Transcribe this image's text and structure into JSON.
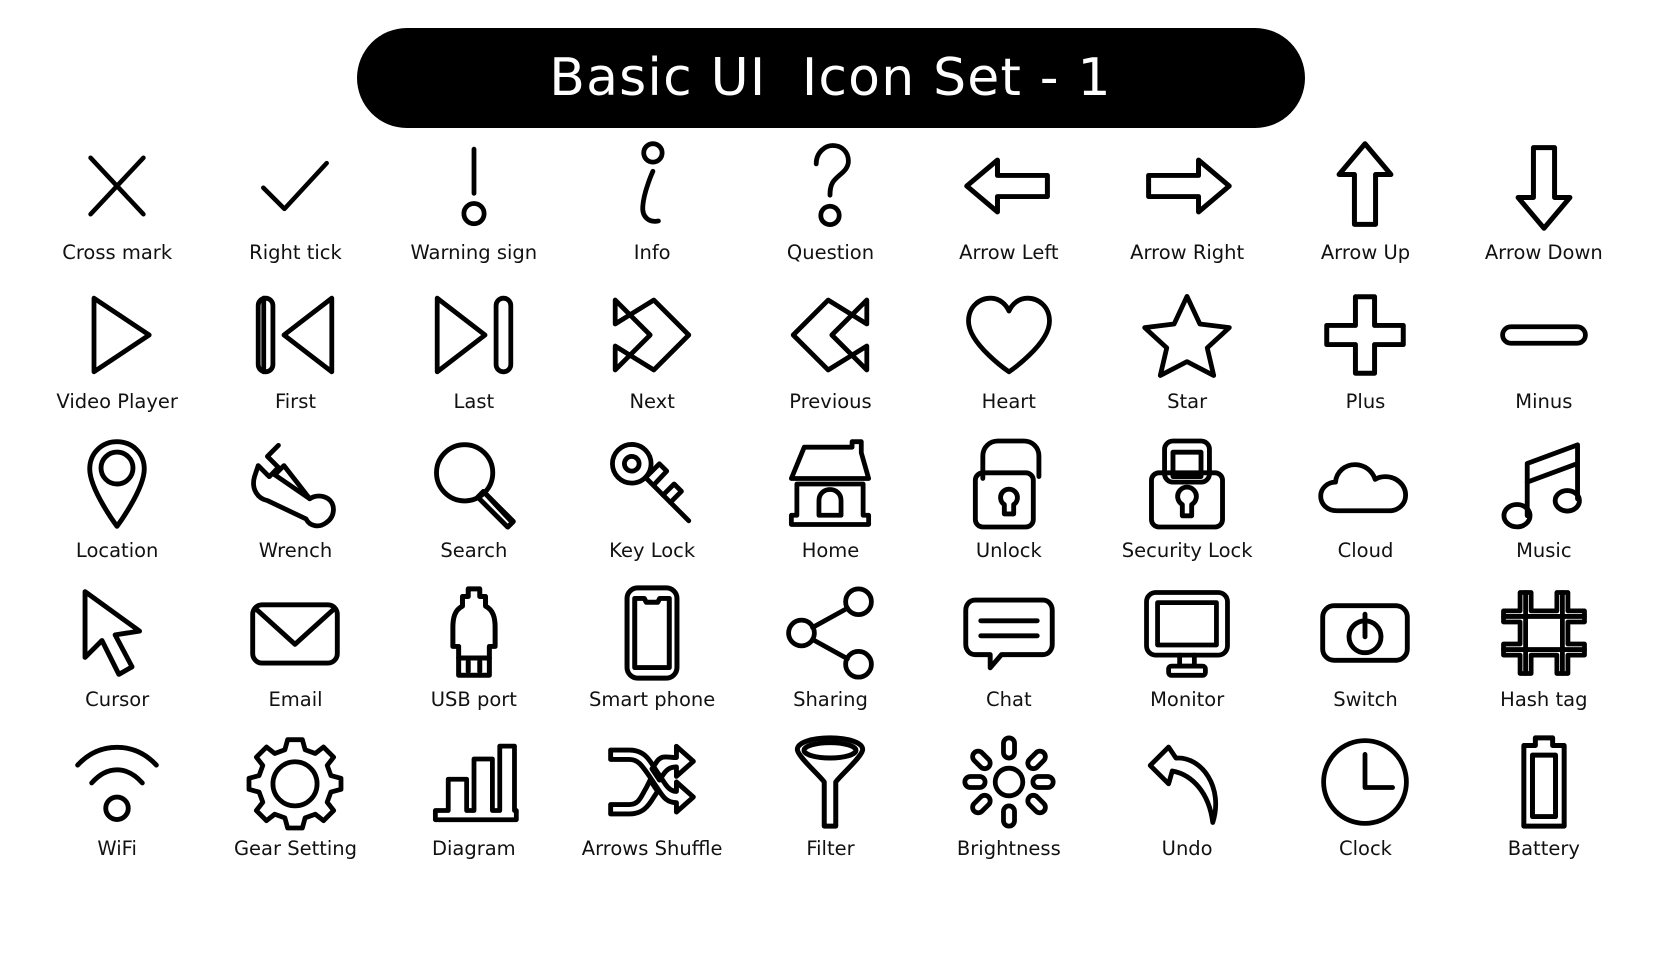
{
  "banner": {
    "title": "Basic UI  Icon Set - 1",
    "background_color": "#000000",
    "text_color": "#ffffff"
  },
  "style": {
    "icon_stroke_color": "#000000",
    "page_background": "#ffffff",
    "caption_color": "#111111",
    "icon_style": "outline"
  },
  "grid": {
    "columns": 9,
    "rows": 5
  },
  "icons": [
    {
      "name": "cross-mark",
      "label": "Cross mark"
    },
    {
      "name": "right-tick",
      "label": "Right tick"
    },
    {
      "name": "warning-sign",
      "label": "Warning sign"
    },
    {
      "name": "info",
      "label": "Info"
    },
    {
      "name": "question",
      "label": "Question"
    },
    {
      "name": "arrow-left",
      "label": "Arrow Left"
    },
    {
      "name": "arrow-right",
      "label": "Arrow Right"
    },
    {
      "name": "arrow-up",
      "label": "Arrow Up"
    },
    {
      "name": "arrow-down",
      "label": "Arrow Down"
    },
    {
      "name": "video-player",
      "label": "Video Player"
    },
    {
      "name": "first",
      "label": "First"
    },
    {
      "name": "last",
      "label": "Last"
    },
    {
      "name": "next",
      "label": "Next"
    },
    {
      "name": "previous",
      "label": "Previous"
    },
    {
      "name": "heart",
      "label": "Heart"
    },
    {
      "name": "star",
      "label": "Star"
    },
    {
      "name": "plus",
      "label": "Plus"
    },
    {
      "name": "minus",
      "label": "Minus"
    },
    {
      "name": "location",
      "label": "Location"
    },
    {
      "name": "wrench",
      "label": "Wrench"
    },
    {
      "name": "search",
      "label": "Search"
    },
    {
      "name": "key-lock",
      "label": "Key Lock"
    },
    {
      "name": "home",
      "label": "Home"
    },
    {
      "name": "unlock",
      "label": "Unlock"
    },
    {
      "name": "security-lock",
      "label": "Security Lock"
    },
    {
      "name": "cloud",
      "label": "Cloud"
    },
    {
      "name": "music",
      "label": "Music"
    },
    {
      "name": "cursor",
      "label": "Cursor"
    },
    {
      "name": "email",
      "label": "Email"
    },
    {
      "name": "usb-port",
      "label": "USB port"
    },
    {
      "name": "smart-phone",
      "label": "Smart phone"
    },
    {
      "name": "sharing",
      "label": "Sharing"
    },
    {
      "name": "chat",
      "label": "Chat"
    },
    {
      "name": "monitor",
      "label": "Monitor"
    },
    {
      "name": "switch",
      "label": "Switch"
    },
    {
      "name": "hash-tag",
      "label": "Hash tag"
    },
    {
      "name": "wifi",
      "label": "WiFi"
    },
    {
      "name": "gear-setting",
      "label": "Gear Setting"
    },
    {
      "name": "diagram",
      "label": "Diagram"
    },
    {
      "name": "arrows-shuffle",
      "label": "Arrows Shuffle"
    },
    {
      "name": "filter",
      "label": "Filter"
    },
    {
      "name": "brightness",
      "label": "Brightness"
    },
    {
      "name": "undo",
      "label": "Undo"
    },
    {
      "name": "clock",
      "label": "Clock"
    },
    {
      "name": "battery",
      "label": "Battery"
    }
  ]
}
